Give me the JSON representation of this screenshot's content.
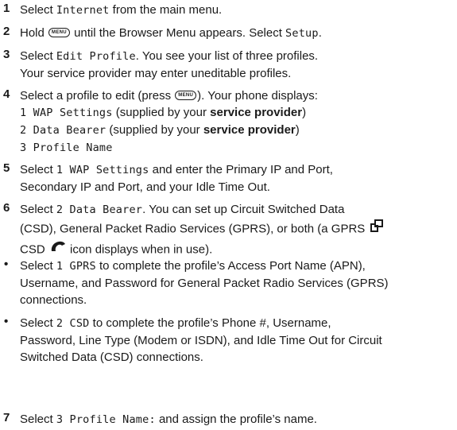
{
  "menu_key_label": "MENU",
  "steps": {
    "s1": {
      "num": "1",
      "a": "Select ",
      "code": "Internet",
      "b": " from the main menu."
    },
    "s2": {
      "num": "2",
      "a": "Hold ",
      "b": " until the Browser Menu appears. Select ",
      "code": "Setup",
      "c": "."
    },
    "s3": {
      "num": "3",
      "a": "Select ",
      "code": "Edit Profile",
      "b": ". You see your list of three profiles.",
      "line2": "Your service provider may enter uneditable profiles."
    },
    "s4": {
      "num": "4",
      "a": "Select a profile to edit (press ",
      "b": "). Your phone displays:",
      "opt1_code": "1 WAP Settings",
      "opt1_a": " (supplied by your ",
      "opt1_bold": "service provider",
      "opt1_b": ")",
      "opt2_code": "2 Data Bearer",
      "opt2_a": " (supplied by your ",
      "opt2_bold": "service provider",
      "opt2_b": ")",
      "opt3_code": "3 Profile Name"
    },
    "s5": {
      "num": "5",
      "a": "Select ",
      "code": "1 WAP Settings",
      "b": " and enter the Primary IP and Port,",
      "line2": "Secondary IP and Port, and your Idle Time Out."
    },
    "s6": {
      "num": "6",
      "a": "Select ",
      "code": "2 Data Bearer",
      "b": ". You can set up Circuit Switched Data",
      "line2": "(CSD), General Packet Radio Services (GPRS), or both (a GPRS ",
      "line3_a": "CSD ",
      "line3_b": " icon displays when in use)."
    },
    "b1": {
      "bullet": "•",
      "a": "Select ",
      "code": "1 GPRS",
      "b": " to complete the profile’s Access Port Name (APN),",
      "line2": "Username, and Password for General Packet Radio Services (GPRS)",
      "line3": "connections."
    },
    "b2": {
      "bullet": "•",
      "a": "Select ",
      "code": "2 CSD",
      "b": "  to complete the profile’s Phone #, Username,",
      "line2": "Password, Line Type (Modem or ISDN), and Idle Time Out for Circuit",
      "line3": "Switched Data (CSD) connections."
    },
    "s7": {
      "num": "7",
      "a": "Select ",
      "code": "3 Profile Name:",
      "b": " and assign the profile’s name."
    }
  }
}
